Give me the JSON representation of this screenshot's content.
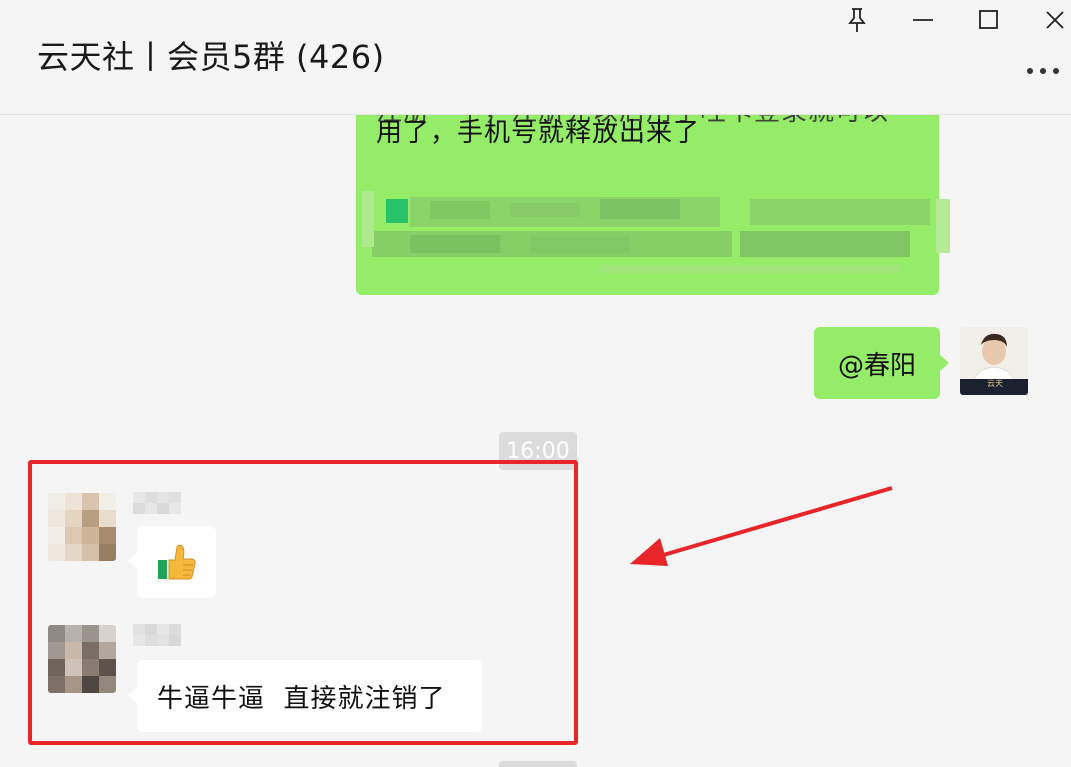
{
  "window": {
    "title": "云天社丨会员5群 (426)",
    "controls": {
      "pin_icon": "pin-icon",
      "minimize_icon": "minimize-icon",
      "maximize_icon": "maximize-icon",
      "close_icon": "close-icon",
      "more_icon": "more-icon"
    }
  },
  "messages": {
    "partial_message": {
      "line1_cut": "注册一个，注册完以后用了哇卡登录就可以",
      "line2": "用了，手机号就释放出来了"
    },
    "mention_message": {
      "text": "@春阳"
    },
    "timestamp": "16:00",
    "thumbs_up_message": {
      "emoji": "👍"
    },
    "reply_message": {
      "text": "牛逼牛逼  直接就注销了"
    }
  },
  "my_avatar": {
    "caption": "云天"
  },
  "colors": {
    "green_bubble": "#95ec69",
    "white_bubble": "#ffffff",
    "background": "#f5f5f5",
    "highlight": "#e8262a"
  }
}
